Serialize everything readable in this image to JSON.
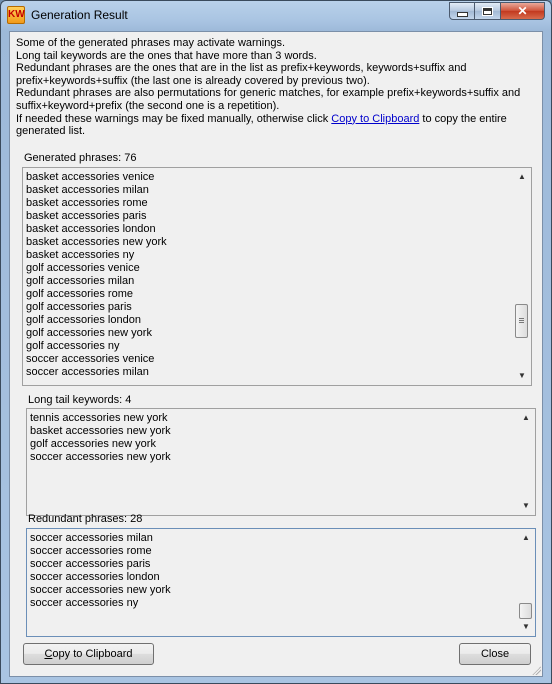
{
  "window": {
    "title": "Generation Result",
    "icon_text": "KW",
    "controls": {
      "minimize": "minimize",
      "maximize": "maximize",
      "close": "✕"
    }
  },
  "description": {
    "lines": [
      "Some of the generated phrases may activate warnings.",
      "Long tail keywords are the ones that have more than 3 words.",
      "Redundant phrases are the ones that are in the list as prefix+keywords, keywords+suffix and",
      "prefix+keywords+suffix (the last one is already covered by previous two).",
      "Redundant phrases are also permutations for generic matches, for example prefix+keywords+suffix and",
      "suffix+keyword+prefix (the second one is a repetition)."
    ],
    "last_line_before": "If needed these warnings may be fixed manually, otherwise click ",
    "link_text": "Copy to Clipboard",
    "last_line_after": " to copy the entire",
    "final_line": "generated list."
  },
  "generated": {
    "label": "Generated phrases: 76",
    "items": [
      "basket accessories venice",
      "basket accessories milan",
      "basket accessories rome",
      "basket accessories paris",
      "basket accessories london",
      "basket accessories new york",
      "basket accessories ny",
      "golf accessories venice",
      "golf accessories milan",
      "golf accessories rome",
      "golf accessories paris",
      "golf accessories london",
      "golf accessories new york",
      "golf accessories ny",
      "soccer accessories venice",
      "soccer accessories milan"
    ],
    "scroll_fraction": 0.8
  },
  "longtail": {
    "label": "Long tail keywords: 4",
    "items": [
      "tennis accessories new york",
      "basket accessories new york",
      "golf accessories new york",
      "soccer accessories new york"
    ]
  },
  "redundant": {
    "label": "Redundant phrases: 28",
    "items": [
      "soccer accessories milan",
      "soccer accessories rome",
      "soccer accessories paris",
      "soccer accessories london",
      "soccer accessories new york",
      "soccer accessories ny"
    ],
    "scroll_fraction": 1.0
  },
  "buttons": {
    "copy_prefix": "",
    "copy_underlined": "C",
    "copy_rest": "opy to Clipboard",
    "close": "Close"
  }
}
